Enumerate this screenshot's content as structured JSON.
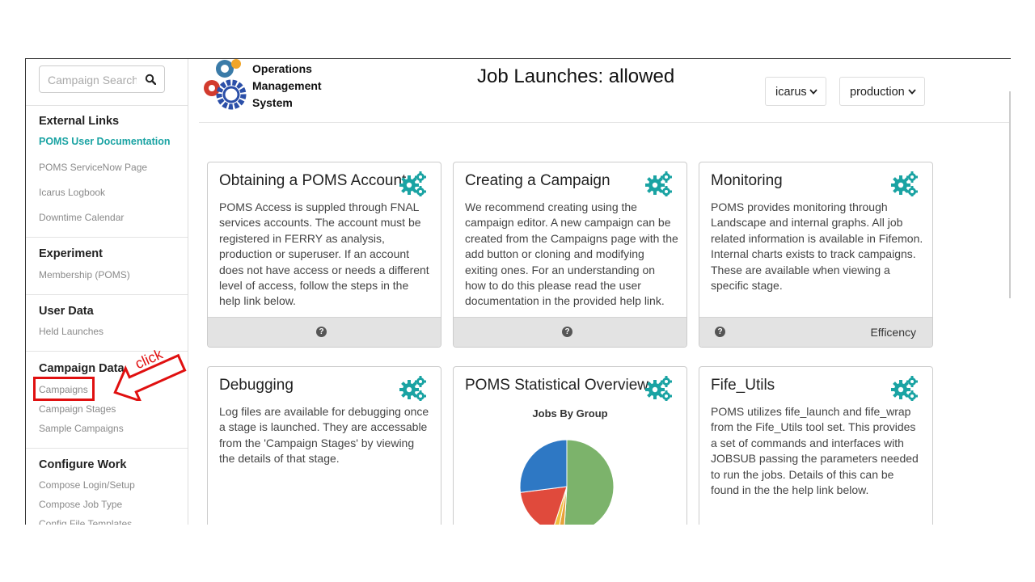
{
  "sidebar": {
    "search_placeholder": "Campaign Search",
    "sections": [
      {
        "title": "External Links",
        "links": [
          "POMS User Documentation",
          "POMS ServiceNow Page",
          "Icarus Logbook",
          "Downtime Calendar"
        ]
      },
      {
        "title": "Experiment",
        "links": [
          "Membership (POMS)"
        ]
      },
      {
        "title": "User Data",
        "links": [
          "Held Launches"
        ]
      },
      {
        "title": "Campaign Data",
        "links": [
          "Campaigns",
          "Campaign Stages",
          "Sample Campaigns"
        ]
      },
      {
        "title": "Configure Work",
        "links": [
          "Compose Login/Setup",
          "Compose Job Type",
          "Config File Templates"
        ]
      }
    ]
  },
  "header": {
    "logo_lines": [
      "Operations",
      "Management",
      "System"
    ],
    "title": "Job Launches: allowed",
    "experiment_select": "icarus",
    "role_select": "production"
  },
  "cards": [
    {
      "title": "Obtaining a POMS Account",
      "body": "POMS Access is suppled through FNAL services accounts. The account must be registered in FERRY as analysis, production or superuser. If an account does not have access or needs a different level of access, follow the steps in the help link below.",
      "footer_link": ""
    },
    {
      "title": "Creating a Campaign",
      "body": "We recommend creating using the campaign editor. A new campaign can be created from the Campaigns page with the add button or cloning and modifying exiting ones. For an understanding on how to do this please read the user documentation in the provided help link.",
      "footer_link": ""
    },
    {
      "title": "Monitoring",
      "body": "POMS provides monitoring through Landscape and internal graphs. All job related information is available in Fifemon. Internal charts exists to track campaigns. These are available when viewing a specific stage.",
      "footer_link": "Efficency"
    },
    {
      "title": "Debugging",
      "body": "Log files are available for debugging once a stage is launched. They are accessable from the 'Campaign Stages' by viewing the details of that stage.",
      "footer_link": ""
    },
    {
      "title": "POMS Statistical Overview",
      "body": "",
      "footer_link": ""
    },
    {
      "title": "Fife_Utils",
      "body": "POMS utilizes fife_launch and fife_wrap from the Fife_Utils tool set. This provides a set of commands and interfaces with JOBSUB passing the parameters needed to run the jobs. Details of this can be found in the the help link below.",
      "footer_link": ""
    }
  ],
  "help_icon": "?",
  "chart_data": {
    "type": "pie",
    "title": "Jobs By Group",
    "values": [
      51,
      2,
      2,
      18,
      27
    ],
    "colors": [
      "#7cb36b",
      "#e8a23a",
      "#f0c040",
      "#e04a3c",
      "#2e78c4"
    ]
  },
  "annotation": {
    "label": "click",
    "color": "#e01010"
  }
}
